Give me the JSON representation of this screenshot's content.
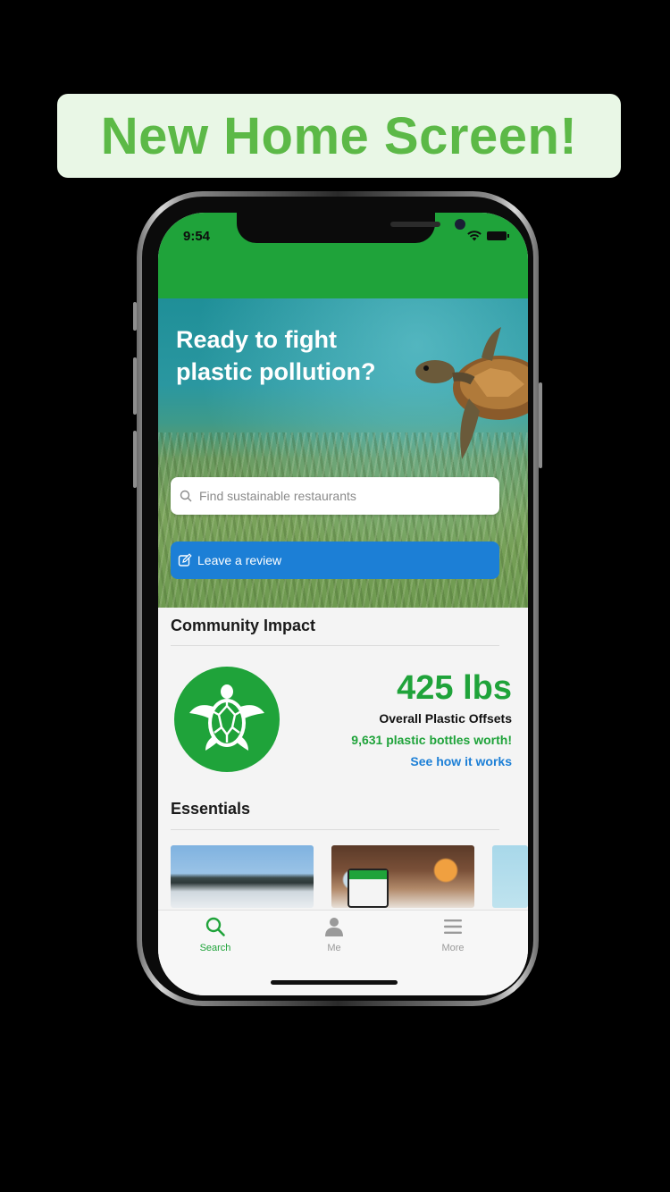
{
  "promo": {
    "title": "New Home Screen!"
  },
  "status_bar": {
    "time": "9:54",
    "icons": [
      "wifi-icon",
      "battery-icon"
    ]
  },
  "hero": {
    "title": "Ready to fight plastic pollution?",
    "search_placeholder": "Find sustainable restaurants",
    "review_button_label": "Leave a review"
  },
  "community_impact": {
    "section_title": "Community Impact",
    "amount": "425 lbs",
    "label": "Overall Plastic Offsets",
    "bottles": "9,631 plastic bottles worth!",
    "link": "See how it works"
  },
  "essentials": {
    "section_title": "Essentials",
    "cards": [
      "beach-photo",
      "restaurant-photo",
      "plant-photo"
    ]
  },
  "tabbar": {
    "tabs": [
      {
        "label": "Search",
        "icon": "search-icon",
        "active": true
      },
      {
        "label": "Me",
        "icon": "person-icon",
        "active": false
      },
      {
        "label": "More",
        "icon": "menu-icon",
        "active": false
      }
    ]
  },
  "colors": {
    "brand_green": "#1fa33a",
    "promo_green": "#5cb947",
    "promo_bg": "#e9f7e6",
    "link_blue": "#1c7fd6"
  }
}
